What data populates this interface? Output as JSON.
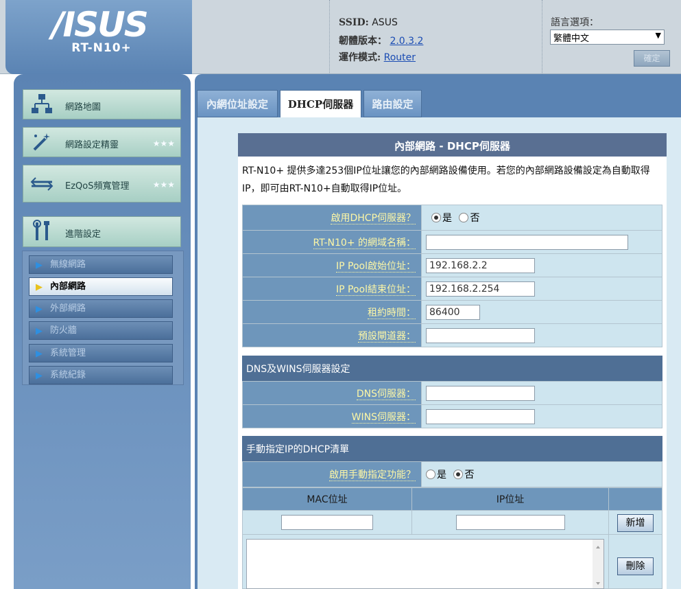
{
  "header": {
    "logo": "/ISUS",
    "model": "RT-N10+",
    "ssid_label": "SSID:",
    "ssid_value": "ASUS",
    "firmware_label": "韌體版本：",
    "firmware_value": "2.0.3.2",
    "mode_label": "運作模式:",
    "mode_value": "Router",
    "language_label": "語言選項：",
    "language_value": "繁體中文",
    "confirm_label": "確定"
  },
  "sidebar": {
    "items": [
      {
        "label": "網路地圖"
      },
      {
        "label": "網路設定精靈",
        "stars": "★★★"
      },
      {
        "label": "EzQoS頻寬管理",
        "stars": "★★★"
      },
      {
        "label": "進階設定"
      }
    ],
    "submenu": [
      {
        "label": "無線網路"
      },
      {
        "label": "內部網路"
      },
      {
        "label": "外部網路"
      },
      {
        "label": "防火牆"
      },
      {
        "label": "系統管理"
      },
      {
        "label": "系統紀錄"
      }
    ]
  },
  "tabs": [
    "內網位址設定",
    "DHCP伺服器",
    "路由設定"
  ],
  "section": {
    "title": "內部網路 - DHCP伺服器",
    "description": "RT-N10+ 提供多達253個IP位址讓您的內部網路設備使用。若您的內部網路設備設定為自動取得IP，即可由RT-N10+自動取得IP位址。"
  },
  "dhcp_form": {
    "enable_label": "啟用DHCP伺服器？",
    "yes_label": "是",
    "no_label": "否",
    "domain_label": "RT-N10+ 的網域名稱：",
    "domain_value": "",
    "start_label": "IP Pool啟始位址：",
    "start_value": "192.168.2.2",
    "end_label": "IP Pool結束位址：",
    "end_value": "192.168.2.254",
    "lease_label": "租約時間：",
    "lease_value": "86400",
    "gateway_label": "預設閘道器：",
    "gateway_value": ""
  },
  "dns_section": {
    "title": "DNS及WINS伺服器設定",
    "dns_label": "DNS伺服器：",
    "dns_value": "",
    "wins_label": "WINS伺服器：",
    "wins_value": ""
  },
  "manual_section": {
    "title": "手動指定IP的DHCP清單",
    "enable_label": "啟用手動指定功能？",
    "yes_label": "是",
    "no_label": "否",
    "mac_header": "MAC位址",
    "ip_header": "IP位址",
    "add_label": "新增",
    "delete_label": "刪除"
  },
  "colors": {
    "accent": "#5a83b3",
    "label_text": "#fdf7a6",
    "label_bg": "#6e96bb"
  }
}
